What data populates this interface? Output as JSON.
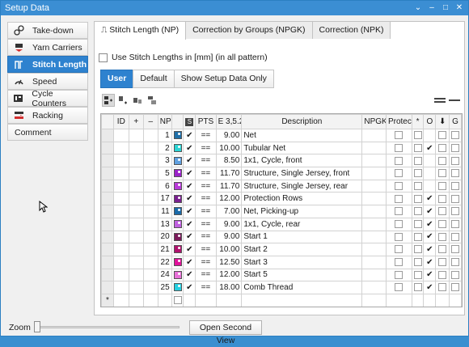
{
  "window": {
    "title": "Setup Data",
    "controls": [
      "⌄",
      "‒",
      "□",
      "✕"
    ]
  },
  "sidebar": {
    "items": [
      {
        "label": "Take-down",
        "icon": "take-down-icon"
      },
      {
        "label": "Yarn Carriers",
        "icon": "yarn-carrier-icon"
      },
      {
        "label": "Stitch Length",
        "icon": "stitch-length-icon",
        "active": true
      },
      {
        "label": "Speed",
        "icon": "speed-icon"
      },
      {
        "label": "Cycle Counters",
        "icon": "cycle-counter-icon"
      },
      {
        "label": "Racking",
        "icon": "racking-icon"
      },
      {
        "label": "Comment"
      }
    ]
  },
  "tabs": [
    {
      "label": "Stitch Length (NP)",
      "active": true,
      "icon": "stitch-icon"
    },
    {
      "label": "Correction by Groups (NPGK)"
    },
    {
      "label": "Correction (NPK)"
    }
  ],
  "use_mm_label": "Use Stitch Lengths in [mm] (in all pattern)",
  "subtabs": [
    {
      "label": "User",
      "active": true
    },
    {
      "label": "Default"
    },
    {
      "label": "Show Setup Data Only"
    }
  ],
  "grid": {
    "headers": [
      "",
      "ID",
      "",
      "",
      "NP",
      "",
      "",
      "PTS",
      "E 3,5.2",
      "Description",
      "NPGK",
      "Protect",
      "*",
      "O",
      "",
      "G"
    ],
    "rows": [
      {
        "np": "1",
        "color": "#1f6fa8",
        "pts": "==",
        "value": "9.00",
        "desc": "Net"
      },
      {
        "np": "2",
        "color": "#2ad4d4",
        "pts": "==",
        "value": "10.00",
        "desc": "Tubular Net"
      },
      {
        "np": "3",
        "color": "#5fa0e0",
        "pts": "==",
        "value": "8.50",
        "desc": "1x1, Cycle, front"
      },
      {
        "np": "5",
        "color": "#9a22c9",
        "pts": "==",
        "value": "11.70",
        "desc": "Structure, Single Jersey, front"
      },
      {
        "np": "6",
        "color": "#b83ad9",
        "pts": "==",
        "value": "11.70",
        "desc": "Structure, Single Jersey, rear"
      },
      {
        "np": "17",
        "color": "#7a1f8f",
        "pts": "==",
        "value": "12.00",
        "desc": "Protection Rows"
      },
      {
        "np": "11",
        "color": "#1a6aa8",
        "pts": "==",
        "value": "7.00",
        "desc": "Net, Picking-up"
      },
      {
        "np": "13",
        "color": "#c060e0",
        "pts": "==",
        "value": "9.00",
        "desc": "1x1, Cycle, rear"
      },
      {
        "np": "20",
        "color": "#7a1a5a",
        "pts": "==",
        "value": "9.00",
        "desc": "Start 1"
      },
      {
        "np": "21",
        "color": "#b0126e",
        "pts": "==",
        "value": "10.00",
        "desc": "Start 2"
      },
      {
        "np": "22",
        "color": "#e0129a",
        "pts": "==",
        "value": "12.50",
        "desc": "Start 3"
      },
      {
        "np": "24",
        "color": "#e870d8",
        "pts": "==",
        "value": "12.00",
        "desc": "Start 5"
      },
      {
        "np": "25",
        "color": "#26cfe0",
        "pts": "==",
        "value": "18.00",
        "desc": "Comb Thread"
      }
    ],
    "new_row_marker": "*"
  },
  "bottom": {
    "zoom_label": "Zoom",
    "zoom_level": 0,
    "second_view_label": "Open Second View"
  }
}
